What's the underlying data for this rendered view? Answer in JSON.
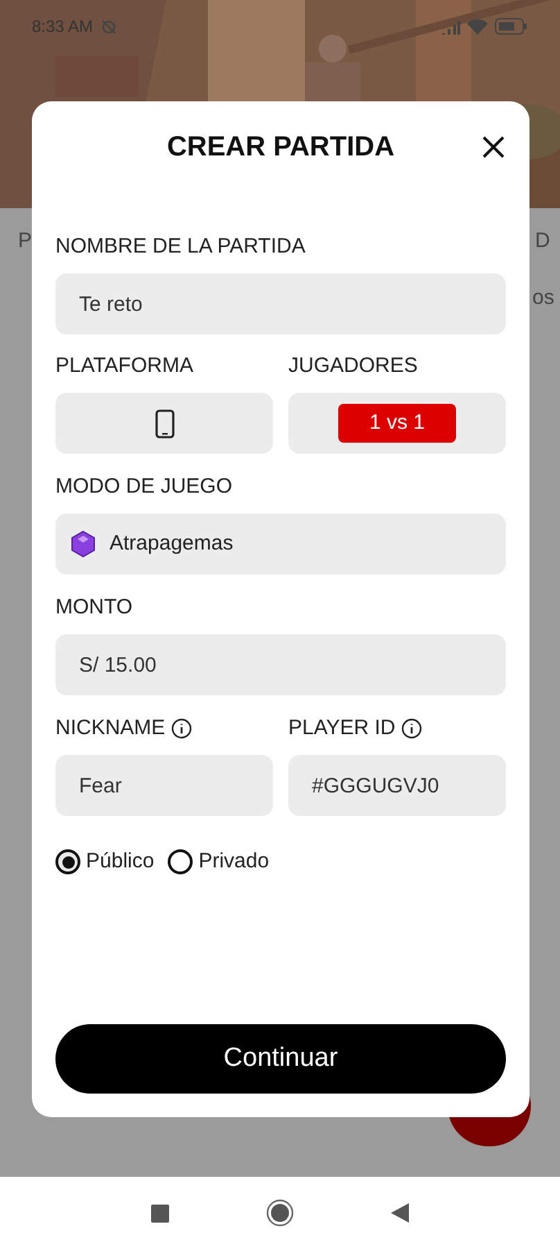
{
  "status_bar": {
    "time": "8:33 AM"
  },
  "background": {
    "tab_left": "P",
    "tab_right": "D",
    "chip_right": "os"
  },
  "dialog": {
    "title": "CREAR PARTIDA",
    "match_name": {
      "label": "NOMBRE DE LA PARTIDA",
      "value": "Te reto"
    },
    "platform": {
      "label": "PLATAFORMA"
    },
    "players": {
      "label": "JUGADORES",
      "value": "1 vs 1"
    },
    "game_mode": {
      "label": "MODO DE JUEGO",
      "value": "Atrapagemas"
    },
    "amount": {
      "label": "MONTO",
      "value": "S/ 15.00"
    },
    "nickname": {
      "label": "NICKNAME",
      "value": "Fear"
    },
    "player_id": {
      "label": "PLAYER ID",
      "value": "#GGGUGVJ0"
    },
    "visibility": [
      {
        "label": "Público",
        "selected": true
      },
      {
        "label": "Privado",
        "selected": false
      }
    ],
    "submit": "Continuar"
  }
}
